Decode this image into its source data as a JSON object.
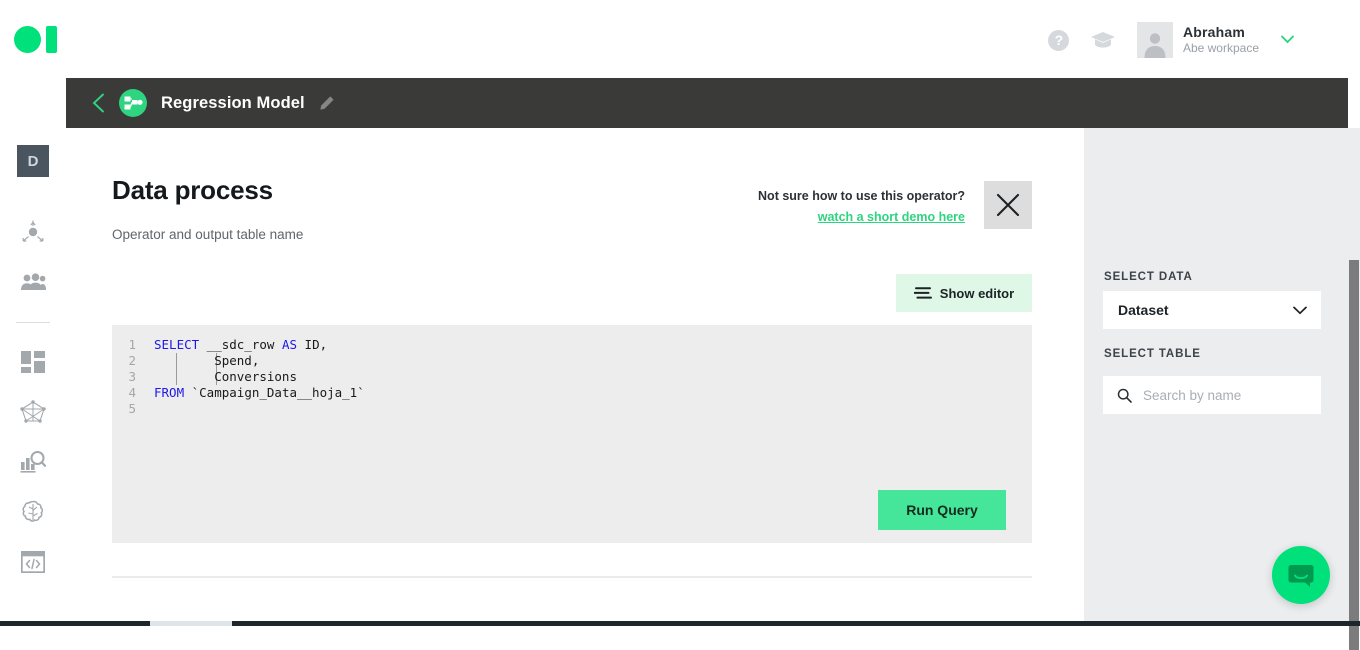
{
  "app": {
    "logo_name": "brand-logo",
    "accent_green": "#00e07b",
    "dark_bar": "#3a3a38",
    "panel_gray": "#ebedef"
  },
  "topbar": {
    "help_icon": "help-circle-icon",
    "help_glyph": "?",
    "academy_icon": "graduation-cap-icon",
    "user": {
      "name": "Abraham",
      "workspace": "Abe workpace",
      "avatar_icon": "user-avatar-icon",
      "chevron_icon": "chevron-down-icon"
    }
  },
  "modelbar": {
    "back_icon": "back-chevron-icon",
    "model_icon": "model-flow-icon",
    "title": "Regression Model",
    "edit_icon": "pencil-edit-icon"
  },
  "sidebar": {
    "badge": "D",
    "items": [
      {
        "name": "sidebar-item-data-ingest",
        "icon": "data-ingest-icon"
      },
      {
        "name": "sidebar-item-team",
        "icon": "team-people-icon"
      },
      {
        "name": "sidebar-item-dashboard",
        "icon": "dashboard-grid-icon"
      },
      {
        "name": "sidebar-item-pipeline",
        "icon": "network-graph-icon"
      },
      {
        "name": "sidebar-item-explore",
        "icon": "analytics-search-icon"
      },
      {
        "name": "sidebar-item-models",
        "icon": "brain-icon"
      },
      {
        "name": "sidebar-item-code",
        "icon": "code-window-icon"
      }
    ]
  },
  "main": {
    "title": "Data process",
    "subtitle": "Operator and output table name",
    "helper_question": "Not sure how to use this operator?",
    "helper_link": "watch a short demo here",
    "close_icon": "close-x-icon",
    "show_editor_label": "Show editor",
    "show_editor_icon": "editor-lines-icon",
    "run_query_label": "Run Query",
    "code": {
      "lines": [
        {
          "number": "1",
          "text": "SELECT __sdc_row AS ID,"
        },
        {
          "number": "2",
          "text": "        Spend,"
        },
        {
          "number": "3",
          "text": "        Conversions"
        },
        {
          "number": "4",
          "text": "FROM `Campaign_Data__hoja_1`"
        },
        {
          "number": "5",
          "text": ""
        }
      ],
      "keywords": [
        "SELECT",
        "AS",
        "FROM"
      ]
    }
  },
  "right_panel": {
    "select_data_label": "SELECT DATA",
    "dataset_value": "Dataset",
    "dataset_chevron_icon": "chevron-down-icon",
    "select_table_label": "SELECT TABLE",
    "search_placeholder": "Search by name",
    "search_icon": "search-icon"
  },
  "intercom": {
    "icon": "chat-bubble-icon"
  }
}
